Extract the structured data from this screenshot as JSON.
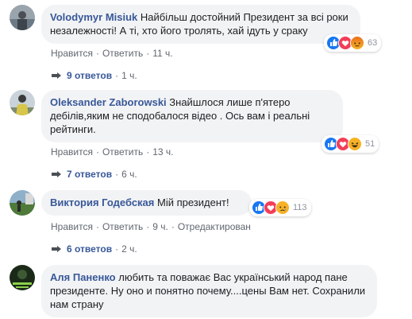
{
  "comments": [
    {
      "author": "Volodymyr Misiuk",
      "text": "Найбільш достойний Президент за всі роки незалежності! А ті, хто його тролять, хай ідуть у сраку",
      "like_label": "Нравится",
      "reply_label": "Ответить",
      "time": "11 ч.",
      "reaction_icons": [
        "like-icon",
        "love-icon",
        "angry-icon"
      ],
      "reaction_count": "63",
      "replies_label": "9 ответов",
      "replies_time": "1 ч."
    },
    {
      "author": "Oleksander Zaborowski",
      "text": "Знайшлося лише п'ятеро дебілів,яким не сподобалося відео . Ось вам і реальні рейтинги.",
      "like_label": "Нравится",
      "reply_label": "Ответить",
      "time": "13 ч.",
      "reaction_icons": [
        "like-icon",
        "love-icon",
        "haha-icon"
      ],
      "reaction_count": "51",
      "replies_label": "7 ответов",
      "replies_time": "6 ч."
    },
    {
      "author": "Виктория Годебская",
      "text": "Мій президент!",
      "like_label": "Нравится",
      "reply_label": "Ответить",
      "time": "9 ч.",
      "edited_label": "Отредактирован",
      "reaction_icons": [
        "like-icon",
        "love-icon",
        "sad-icon"
      ],
      "reaction_count": "113",
      "replies_label": "6 ответов",
      "replies_time": "2 ч."
    },
    {
      "author": "Аля Паненко",
      "text": "любить та поважає Вас український народ пане президенте. Ну оно и понятно почему....цены Вам нет. Сохранили нам страну"
    }
  ],
  "colors": {
    "author_link": "#385898",
    "bubble_bg": "#f2f3f5",
    "meta_text": "#606770",
    "like_blue": "#1877f2",
    "love_red": "#f33e58",
    "emoji_yellow": "#f7b125"
  }
}
